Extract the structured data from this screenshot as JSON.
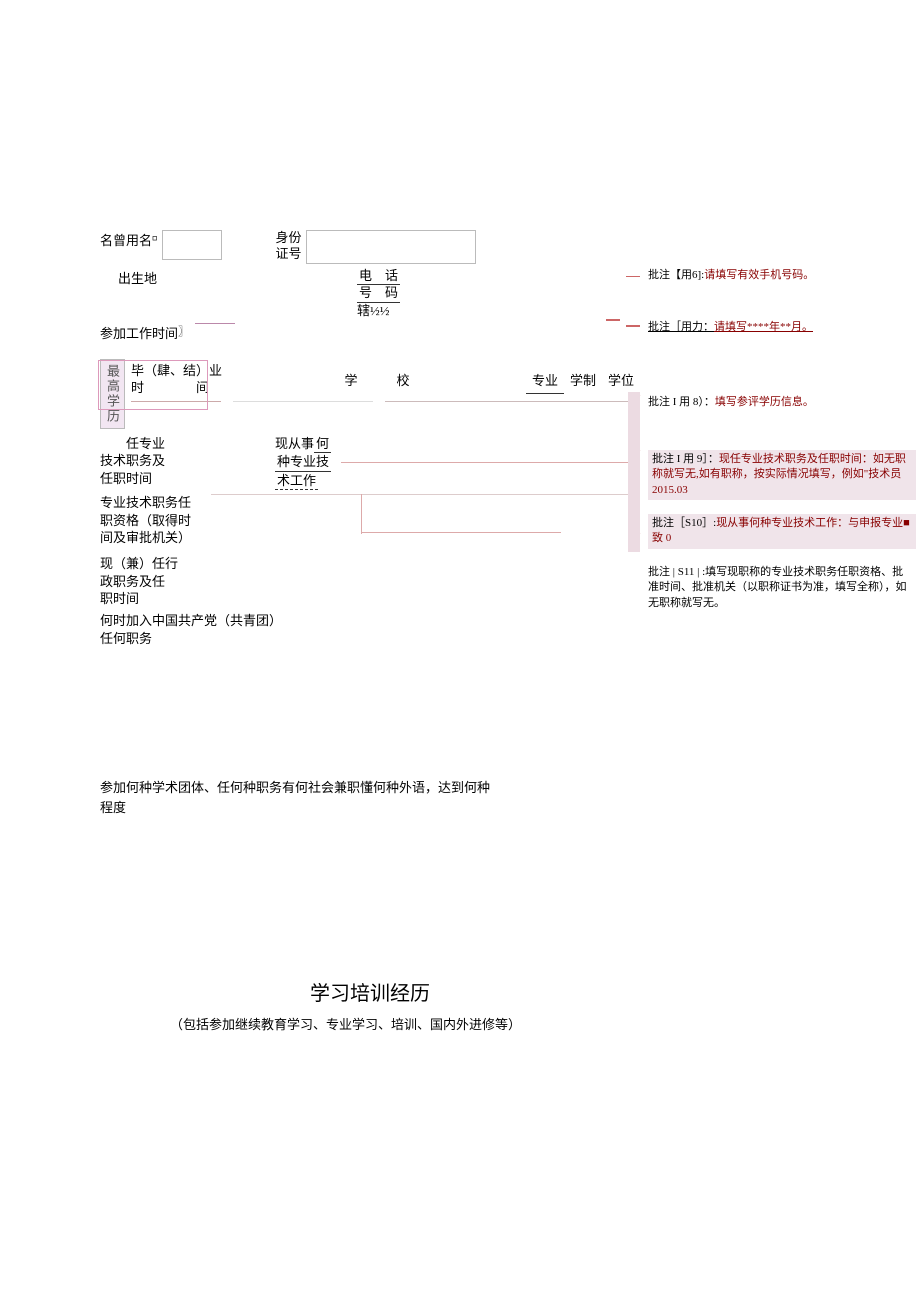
{
  "form": {
    "row1": {
      "label_name_former": "名曾用名",
      "label_id": "身份\n证号"
    },
    "row2": {
      "label_birthplace": "出生地",
      "label_phone_line1": "电　话",
      "label_phone_line2": "号　码",
      "label_phone_line3": "辖½½"
    },
    "row3": {
      "label_workstart": "参加工作时间"
    },
    "edu": {
      "vlabel": "最高学历",
      "col_time": "毕（肆、结）业\n时　　　　间",
      "col_school": "学　　　校",
      "col_major": "专业",
      "col_system": "学制",
      "col_degree": "学位"
    },
    "row_position": {
      "label_left": "　　任专业\n技术职务及\n任职时间",
      "label_right": "现从事",
      "label_right2": "何",
      "label_right3": "种专业技",
      "label_right4": "术工作"
    },
    "row_qualification": {
      "label": "专业技术职务任\n职资格（取得时\n间及审批机关）"
    },
    "row_admin": {
      "label": "现（兼）任行\n政职务及任\n职时间"
    },
    "row_party": {
      "label": "何时加入中国共产党（共青团）\n任何职务"
    },
    "row_academic": {
      "label": "参加何种学术团体、任何种职务有何社会兼职懂何种外语，达到何种\n程度"
    }
  },
  "annotations": {
    "a6": {
      "tag": "批注【用6]:",
      "text": "请填写有效手机号码。"
    },
    "a7": {
      "tag": "批注［用力：",
      "text": "请填写****年**月。"
    },
    "a8": {
      "tag": "批注 I 用 8）：",
      "text": "填写参评学历信息。"
    },
    "a9": {
      "tag": "批注 I 用 9］：",
      "text": "现任专业技术职务及任职时间：如无职称就写无,如有职称，按实际情况填写，例如\"技术员2015.03"
    },
    "a10": {
      "tag": "批注［S10］:",
      "text": "现从事何种专业技术工作：与申报专业■致 0"
    },
    "a11": {
      "tag": "批注 | S11 | :",
      "text": "填写现职称的专业技术职务任职资格、批准时间、批准机关（以职称证书为准，填写全称），如无职称就写无。"
    }
  },
  "section": {
    "title": "学习培训经历",
    "subtitle": "（包括参加继续教育学习、专业学习、培训、国内外进修等）"
  }
}
